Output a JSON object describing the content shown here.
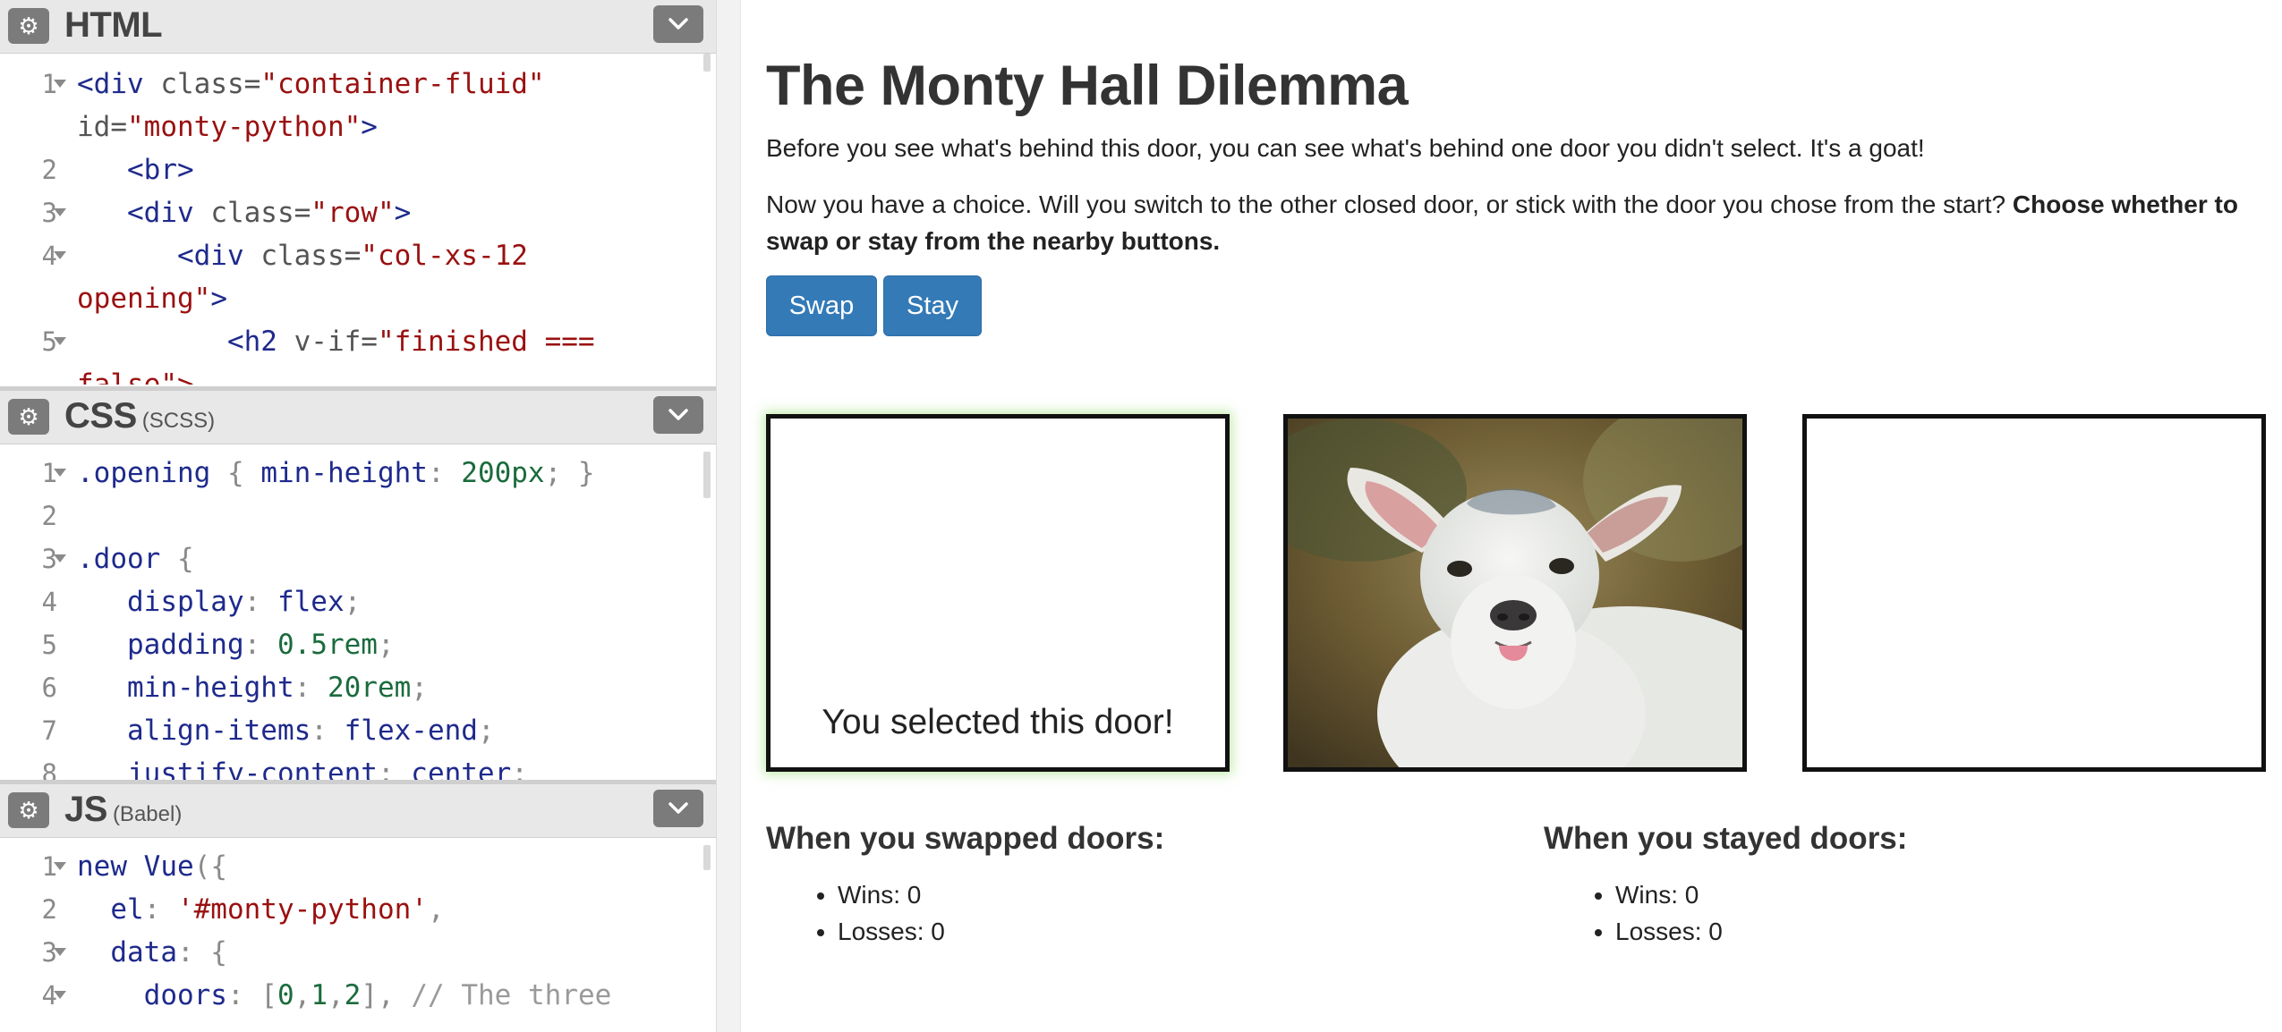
{
  "editor": {
    "html_panel": {
      "title": "HTML",
      "subtitle": "",
      "lines": [
        {
          "n": "1",
          "fold": true,
          "parts": [
            [
              "c-tag",
              "<div "
            ],
            [
              "c-attr",
              "class="
            ],
            [
              "c-str",
              "\"container-fluid\""
            ]
          ]
        },
        {
          "n": "",
          "fold": false,
          "parts": [
            [
              "c-attr",
              "id="
            ],
            [
              "c-str",
              "\"monty-python\""
            ],
            [
              "c-tag",
              ">"
            ]
          ]
        },
        {
          "n": "2",
          "fold": false,
          "parts": [
            [
              "c-tag",
              "   <br>"
            ]
          ]
        },
        {
          "n": "3",
          "fold": true,
          "parts": [
            [
              "c-tag",
              "   <div "
            ],
            [
              "c-attr",
              "class="
            ],
            [
              "c-str",
              "\"row\""
            ],
            [
              "c-tag",
              ">"
            ]
          ]
        },
        {
          "n": "4",
          "fold": true,
          "parts": [
            [
              "c-tag",
              "      <div "
            ],
            [
              "c-attr",
              "class="
            ],
            [
              "c-str",
              "\"col-xs-12"
            ]
          ]
        },
        {
          "n": "",
          "fold": false,
          "parts": [
            [
              "c-str",
              "opening\""
            ],
            [
              "c-tag",
              ">"
            ]
          ]
        },
        {
          "n": "5",
          "fold": true,
          "parts": [
            [
              "c-tag",
              "         <h2 "
            ],
            [
              "c-attr",
              "v-if="
            ],
            [
              "c-str",
              "\"finished ==="
            ]
          ]
        },
        {
          "n": "",
          "fold": false,
          "parts": [
            [
              "c-str",
              "false\">"
            ]
          ]
        }
      ]
    },
    "css_panel": {
      "title": "CSS",
      "subtitle": "(SCSS)",
      "lines": [
        {
          "n": "1",
          "fold": true,
          "parts": [
            [
              "c-sel",
              ".opening "
            ],
            [
              "c-punct",
              "{ "
            ],
            [
              "c-prop",
              "min-height"
            ],
            [
              "c-punct",
              ": "
            ],
            [
              "c-num",
              "200px"
            ],
            [
              "c-punct",
              "; }"
            ]
          ]
        },
        {
          "n": "2",
          "fold": false,
          "parts": []
        },
        {
          "n": "3",
          "fold": true,
          "parts": [
            [
              "c-sel",
              ".door "
            ],
            [
              "c-punct",
              "{"
            ]
          ]
        },
        {
          "n": "4",
          "fold": false,
          "parts": [
            [
              "c-prop",
              "   display"
            ],
            [
              "c-punct",
              ": "
            ],
            [
              "c-prop",
              "flex"
            ],
            [
              "c-punct",
              ";"
            ]
          ]
        },
        {
          "n": "5",
          "fold": false,
          "parts": [
            [
              "c-prop",
              "   padding"
            ],
            [
              "c-punct",
              ": "
            ],
            [
              "c-num",
              "0.5rem"
            ],
            [
              "c-punct",
              ";"
            ]
          ]
        },
        {
          "n": "6",
          "fold": false,
          "parts": [
            [
              "c-prop",
              "   min-height"
            ],
            [
              "c-punct",
              ": "
            ],
            [
              "c-num",
              "20rem"
            ],
            [
              "c-punct",
              ";"
            ]
          ]
        },
        {
          "n": "7",
          "fold": false,
          "parts": [
            [
              "c-prop",
              "   align-items"
            ],
            [
              "c-punct",
              ": "
            ],
            [
              "c-prop",
              "flex-end"
            ],
            [
              "c-punct",
              ";"
            ]
          ]
        },
        {
          "n": "8",
          "fold": false,
          "parts": [
            [
              "c-prop",
              "   justify-content"
            ],
            [
              "c-punct",
              ": "
            ],
            [
              "c-prop",
              "center"
            ],
            [
              "c-punct",
              ";"
            ]
          ]
        }
      ]
    },
    "js_panel": {
      "title": "JS",
      "subtitle": "(Babel)",
      "lines": [
        {
          "n": "1",
          "fold": true,
          "parts": [
            [
              "c-tag",
              "new "
            ],
            [
              "c-sel",
              "Vue"
            ],
            [
              "c-punct",
              "({"
            ]
          ]
        },
        {
          "n": "2",
          "fold": false,
          "parts": [
            [
              "c-prop",
              "  el"
            ],
            [
              "c-punct",
              ": "
            ],
            [
              "c-str",
              "'#monty-python'"
            ],
            [
              "c-punct",
              ","
            ]
          ]
        },
        {
          "n": "3",
          "fold": true,
          "parts": [
            [
              "c-prop",
              "  data"
            ],
            [
              "c-punct",
              ": {"
            ]
          ]
        },
        {
          "n": "4",
          "fold": true,
          "parts": [
            [
              "c-prop",
              "    doors"
            ],
            [
              "c-punct",
              ": ["
            ],
            [
              "c-num",
              "0"
            ],
            [
              "c-punct",
              ","
            ],
            [
              "c-num",
              "1"
            ],
            [
              "c-punct",
              ","
            ],
            [
              "c-num",
              "2"
            ],
            [
              "c-punct",
              "], "
            ],
            [
              "c-comment",
              "// The three"
            ]
          ]
        }
      ]
    }
  },
  "result": {
    "title": "The Monty Hall Dilemma",
    "intro": "Before you see what's behind this door, you can see what's behind one door you didn't select. It's a goat!",
    "choice_text": "Now you have a choice. Will you switch to the other closed door, or stick with the door you chose from the start?",
    "choice_bold": "Choose whether to swap or stay from the nearby buttons.",
    "swap_label": "Swap",
    "stay_label": "Stay",
    "doors": [
      {
        "label": "You selected this door!",
        "selected": true,
        "content": "empty"
      },
      {
        "label": "",
        "selected": false,
        "content": "goat"
      },
      {
        "label": "",
        "selected": false,
        "content": "empty"
      }
    ],
    "swapped": {
      "heading": "When you swapped doors:",
      "wins": "Wins: 0",
      "losses": "Losses: 0"
    },
    "stayed": {
      "heading": "When you stayed doors:",
      "wins": "Wins: 0",
      "losses": "Losses: 0"
    }
  },
  "colors": {
    "primary_button": "#337ab7",
    "editor_header": "#e8e8e8",
    "selected_glow": "#96dc6e"
  },
  "icons": {
    "settings": "gear-icon",
    "collapse": "chevron-down-icon"
  }
}
